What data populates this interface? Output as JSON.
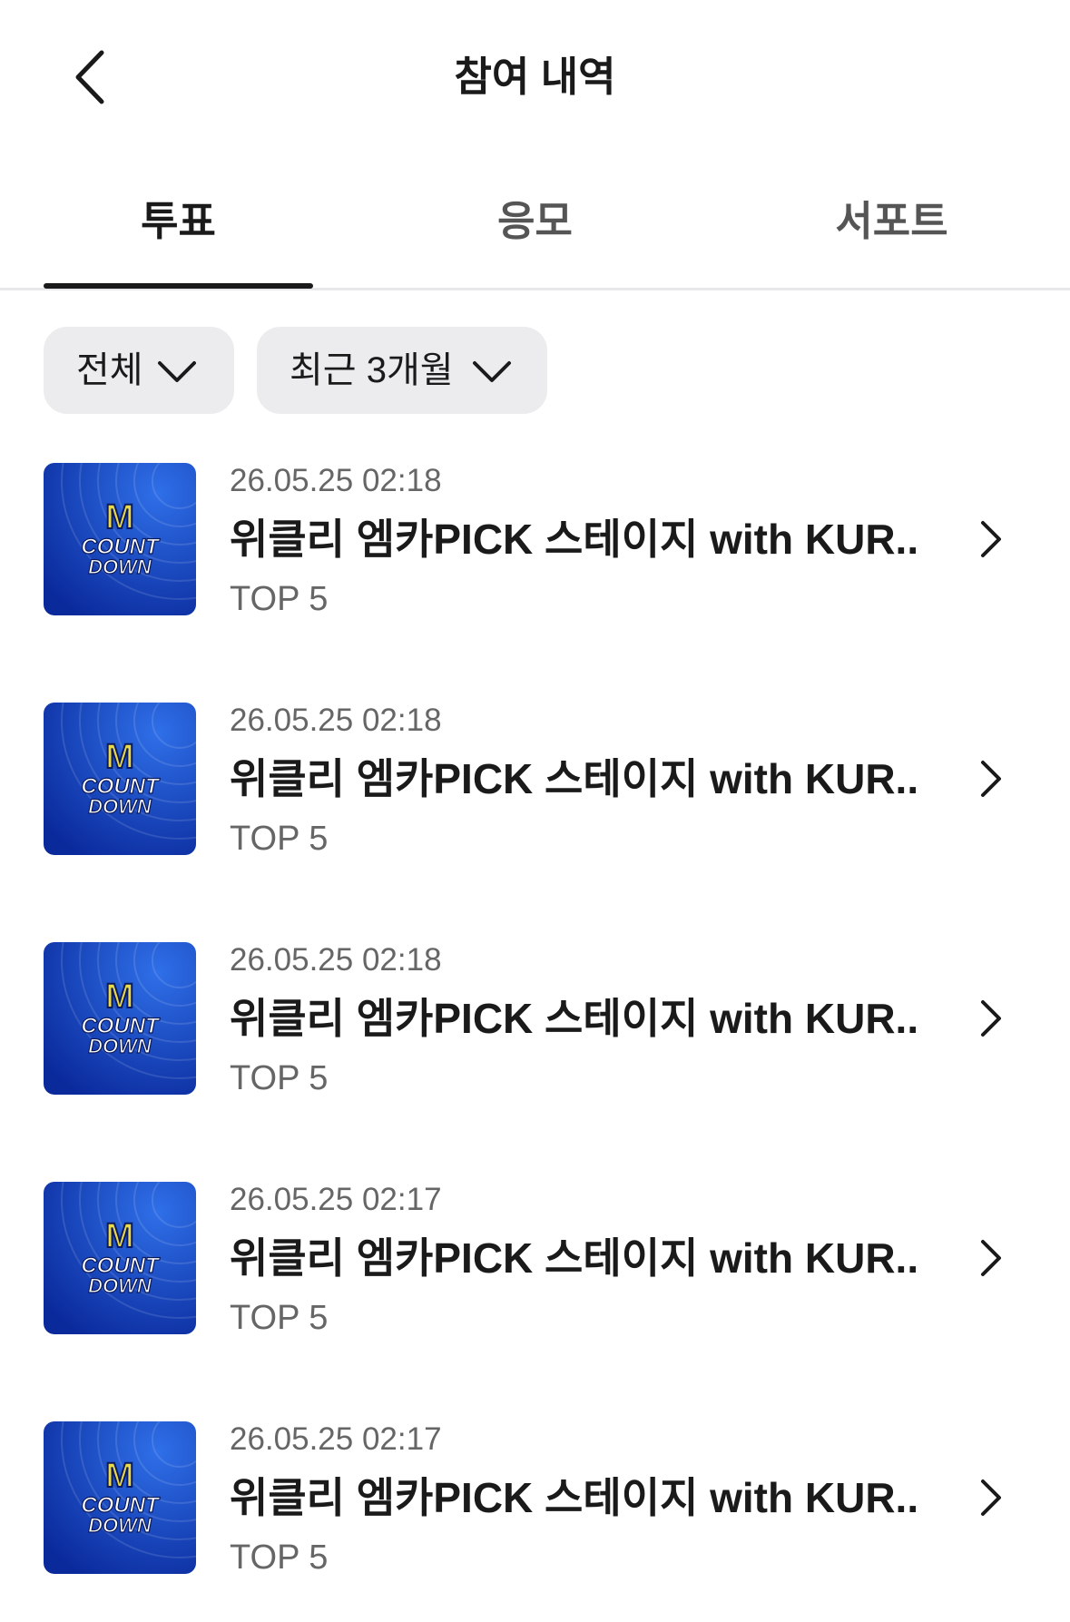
{
  "header": {
    "title": "참여 내역",
    "back_icon": "chevron-left-icon"
  },
  "tabs": [
    {
      "label": "투표",
      "active": true
    },
    {
      "label": "응모",
      "active": false
    },
    {
      "label": "서포트",
      "active": false
    }
  ],
  "filters": [
    {
      "label": "전체",
      "icon": "chevron-down-icon"
    },
    {
      "label": "최근 3개월",
      "icon": "chevron-down-icon"
    }
  ],
  "thumbnail": {
    "logo_text": [
      "M",
      "COUNT",
      "DOWN"
    ],
    "colors": {
      "dark": "#0a2a9c",
      "light": "#2f6fe8",
      "accent": "#e8d84a"
    }
  },
  "items": [
    {
      "date": "26.05.25 02:18",
      "title": "위클리 엠카PICK 스테이지 with KUR...",
      "sub": "TOP 5"
    },
    {
      "date": "26.05.25 02:18",
      "title": "위클리 엠카PICK 스테이지 with KUR...",
      "sub": "TOP 5"
    },
    {
      "date": "26.05.25 02:18",
      "title": "위클리 엠카PICK 스테이지 with KUR...",
      "sub": "TOP 5"
    },
    {
      "date": "26.05.25 02:17",
      "title": "위클리 엠카PICK 스테이지 with KUR...",
      "sub": "TOP 5"
    },
    {
      "date": "26.05.25 02:17",
      "title": "위클리 엠카PICK 스테이지 with KUR...",
      "sub": "TOP 5"
    }
  ]
}
